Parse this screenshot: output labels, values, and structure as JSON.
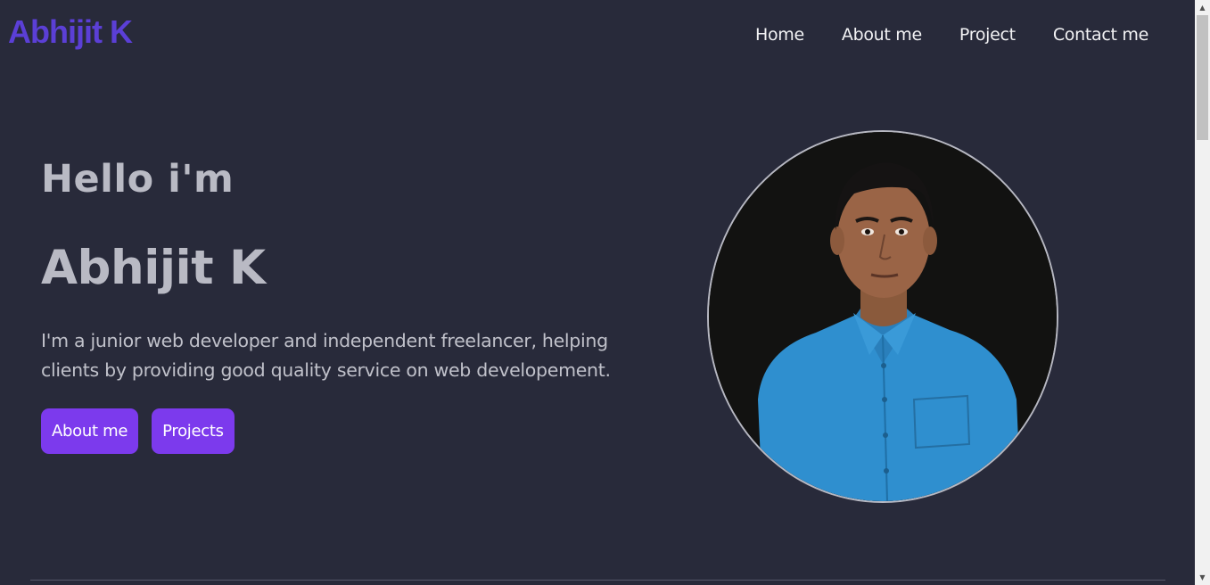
{
  "header": {
    "logo": "Abhijit K",
    "nav": {
      "home": "Home",
      "about": "About me",
      "project": "Project",
      "contact": "Contact me"
    }
  },
  "hero": {
    "greeting": "Hello i'm",
    "name": "Abhijit K",
    "bio": "I'm a junior web developer and independent freelancer, helping clients by providing good quality service on web developement.",
    "buttons": {
      "about": "About me",
      "projects": "Projects"
    }
  },
  "colors": {
    "background": "#282a3a",
    "logo": "#5b3fd6",
    "button": "#7c3aed",
    "heading": "#b9bac4"
  },
  "icons": {
    "scroll_up": "triangle-up-icon",
    "scroll_down": "triangle-down-icon"
  }
}
